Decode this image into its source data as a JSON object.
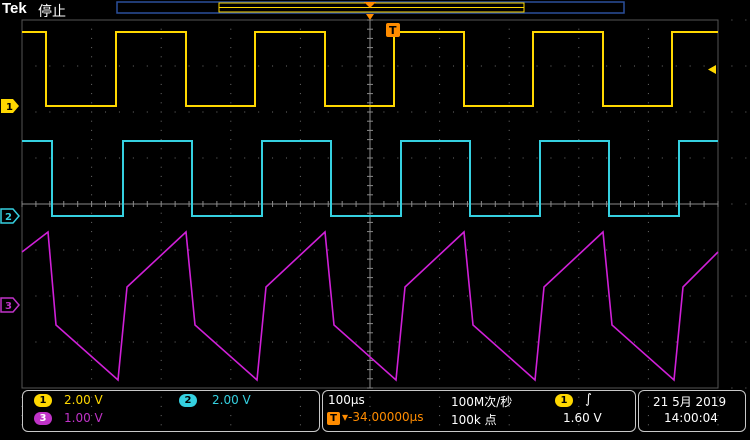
{
  "header": {
    "brand": "Tek",
    "state": "停止"
  },
  "markers": {
    "trigger_label": "T",
    "ch1_label": "1",
    "ch2_label": "2",
    "ch3_label": "3"
  },
  "bottom": {
    "ch1": {
      "label": "1",
      "scale": "2.00 V",
      "color": "#ffd800"
    },
    "ch2": {
      "label": "2",
      "scale": "2.00 V",
      "color": "#35d0e0"
    },
    "ch3": {
      "label": "3",
      "scale": "1.00 V",
      "color": "#c033c8"
    },
    "timebase": "100µs",
    "sample_rate": "100M次/秒",
    "trigger_pos_label": "T",
    "trigger_offset": "▾-34.00000µs",
    "record_length": "100k 点",
    "trigger_source": "1",
    "trigger_slope": "∫",
    "trigger_level": "1.60 V",
    "date": "21 5月 2019",
    "time": "14:00:04"
  },
  "colors": {
    "ch1": "#ffd800",
    "ch2": "#35d0e0",
    "ch3": "#d020d8",
    "trigger": "#ff8c00",
    "grid": "#6e6e6e"
  }
}
